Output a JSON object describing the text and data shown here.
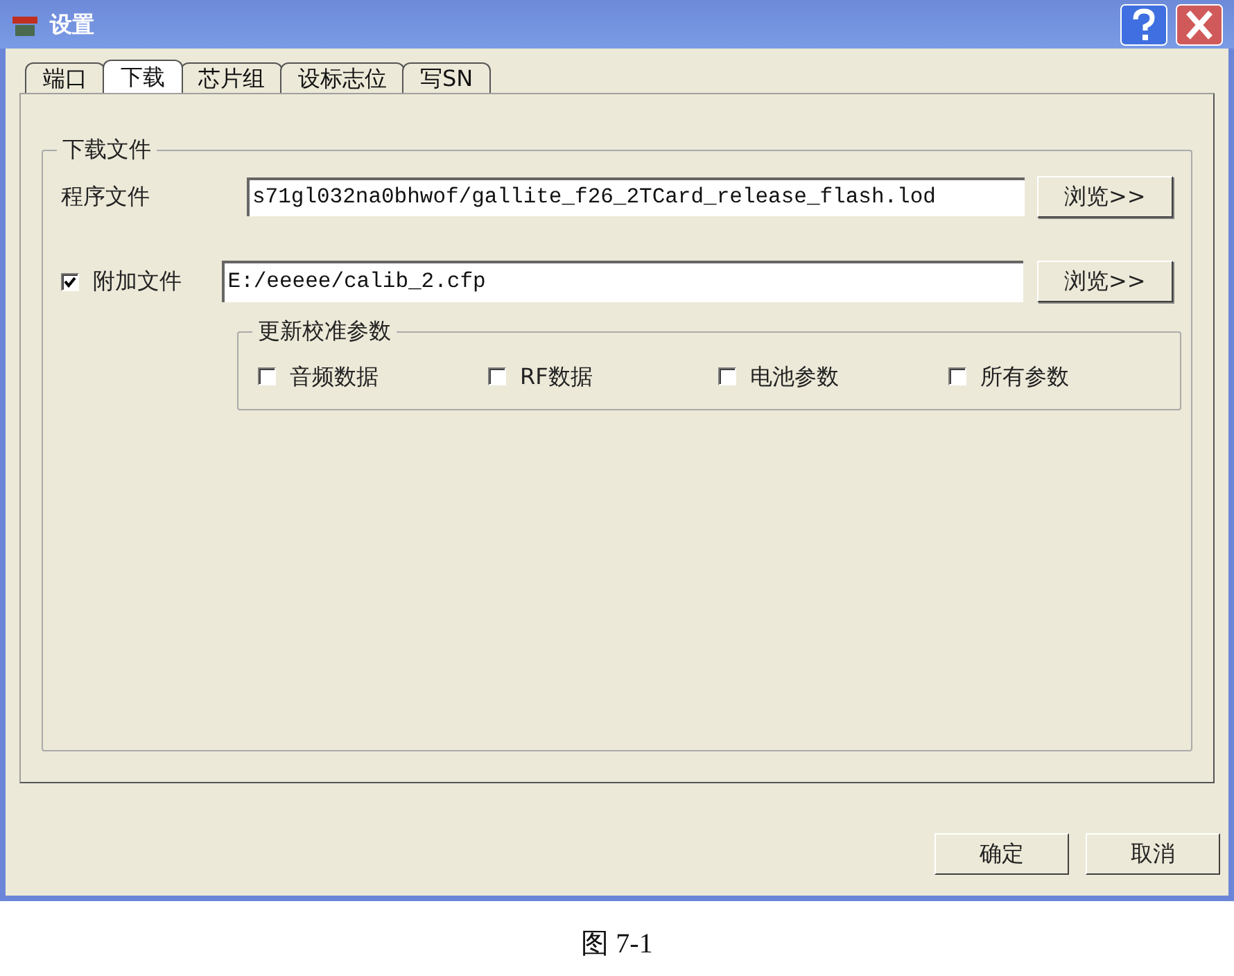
{
  "window": {
    "title": "设置"
  },
  "tabs": [
    {
      "label": "端口",
      "selected": false
    },
    {
      "label": "下载",
      "selected": true
    },
    {
      "label": "芯片组",
      "selected": false
    },
    {
      "label": "设标志位",
      "selected": false
    },
    {
      "label": "写SN",
      "selected": false
    }
  ],
  "download_group": {
    "title": "下载文件",
    "program_file": {
      "label": "程序文件",
      "value": "s71gl032na0bhwof/gallite_f26_2TCard_release_flash.lod",
      "button": "浏览>>"
    },
    "attach_file": {
      "label": "附加文件",
      "checked": true,
      "value": "E:/eeeee/calib_2.cfp",
      "button": "浏览>>"
    },
    "calibration_group": {
      "title": "更新校准参数",
      "options": [
        {
          "label": "音频数据",
          "checked": false
        },
        {
          "label": "RF数据",
          "checked": false
        },
        {
          "label": "电池参数",
          "checked": false
        },
        {
          "label": "所有参数",
          "checked": false
        }
      ]
    }
  },
  "footer_buttons": [
    "确定",
    "取消"
  ],
  "caption": "图 7-1"
}
